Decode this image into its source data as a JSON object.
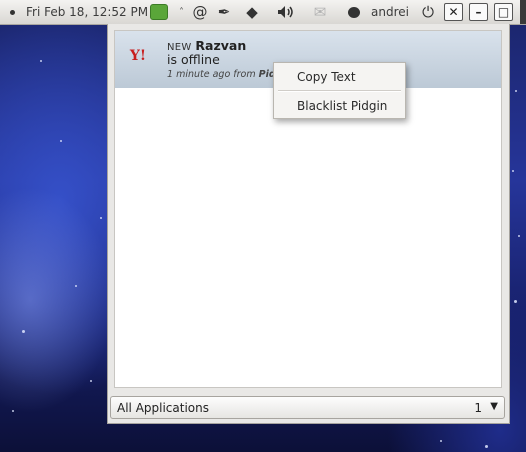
{
  "panel": {
    "clock": "Fri Feb 18, 12:52 PM",
    "separator_glyph": "˄",
    "username": "andrei",
    "icons": {
      "app": "green-app-indicator-icon",
      "spiral": "@",
      "pen": "✒",
      "dropbox": "◆",
      "volume": "🔊",
      "mail": "✉",
      "power": "⏻"
    },
    "window_buttons": {
      "close": "✕",
      "minimize": "–",
      "maximize": "□"
    }
  },
  "notification": {
    "app_icon_glyph": "Y!",
    "new_label": "NEW",
    "sender": "Razvan",
    "message": "is offline",
    "time": "1 minute ago",
    "from_label": "from",
    "source": "Pidgin"
  },
  "context_menu": {
    "items": [
      "Copy Text",
      "Blacklist Pidgin"
    ]
  },
  "filter": {
    "label": "All Applications",
    "count": "1",
    "arrow": "▼"
  },
  "colors": {
    "accent_app_green": "#5aa639",
    "notification_bg": "#c9d4df",
    "yahoo_red": "#c81e1e"
  }
}
